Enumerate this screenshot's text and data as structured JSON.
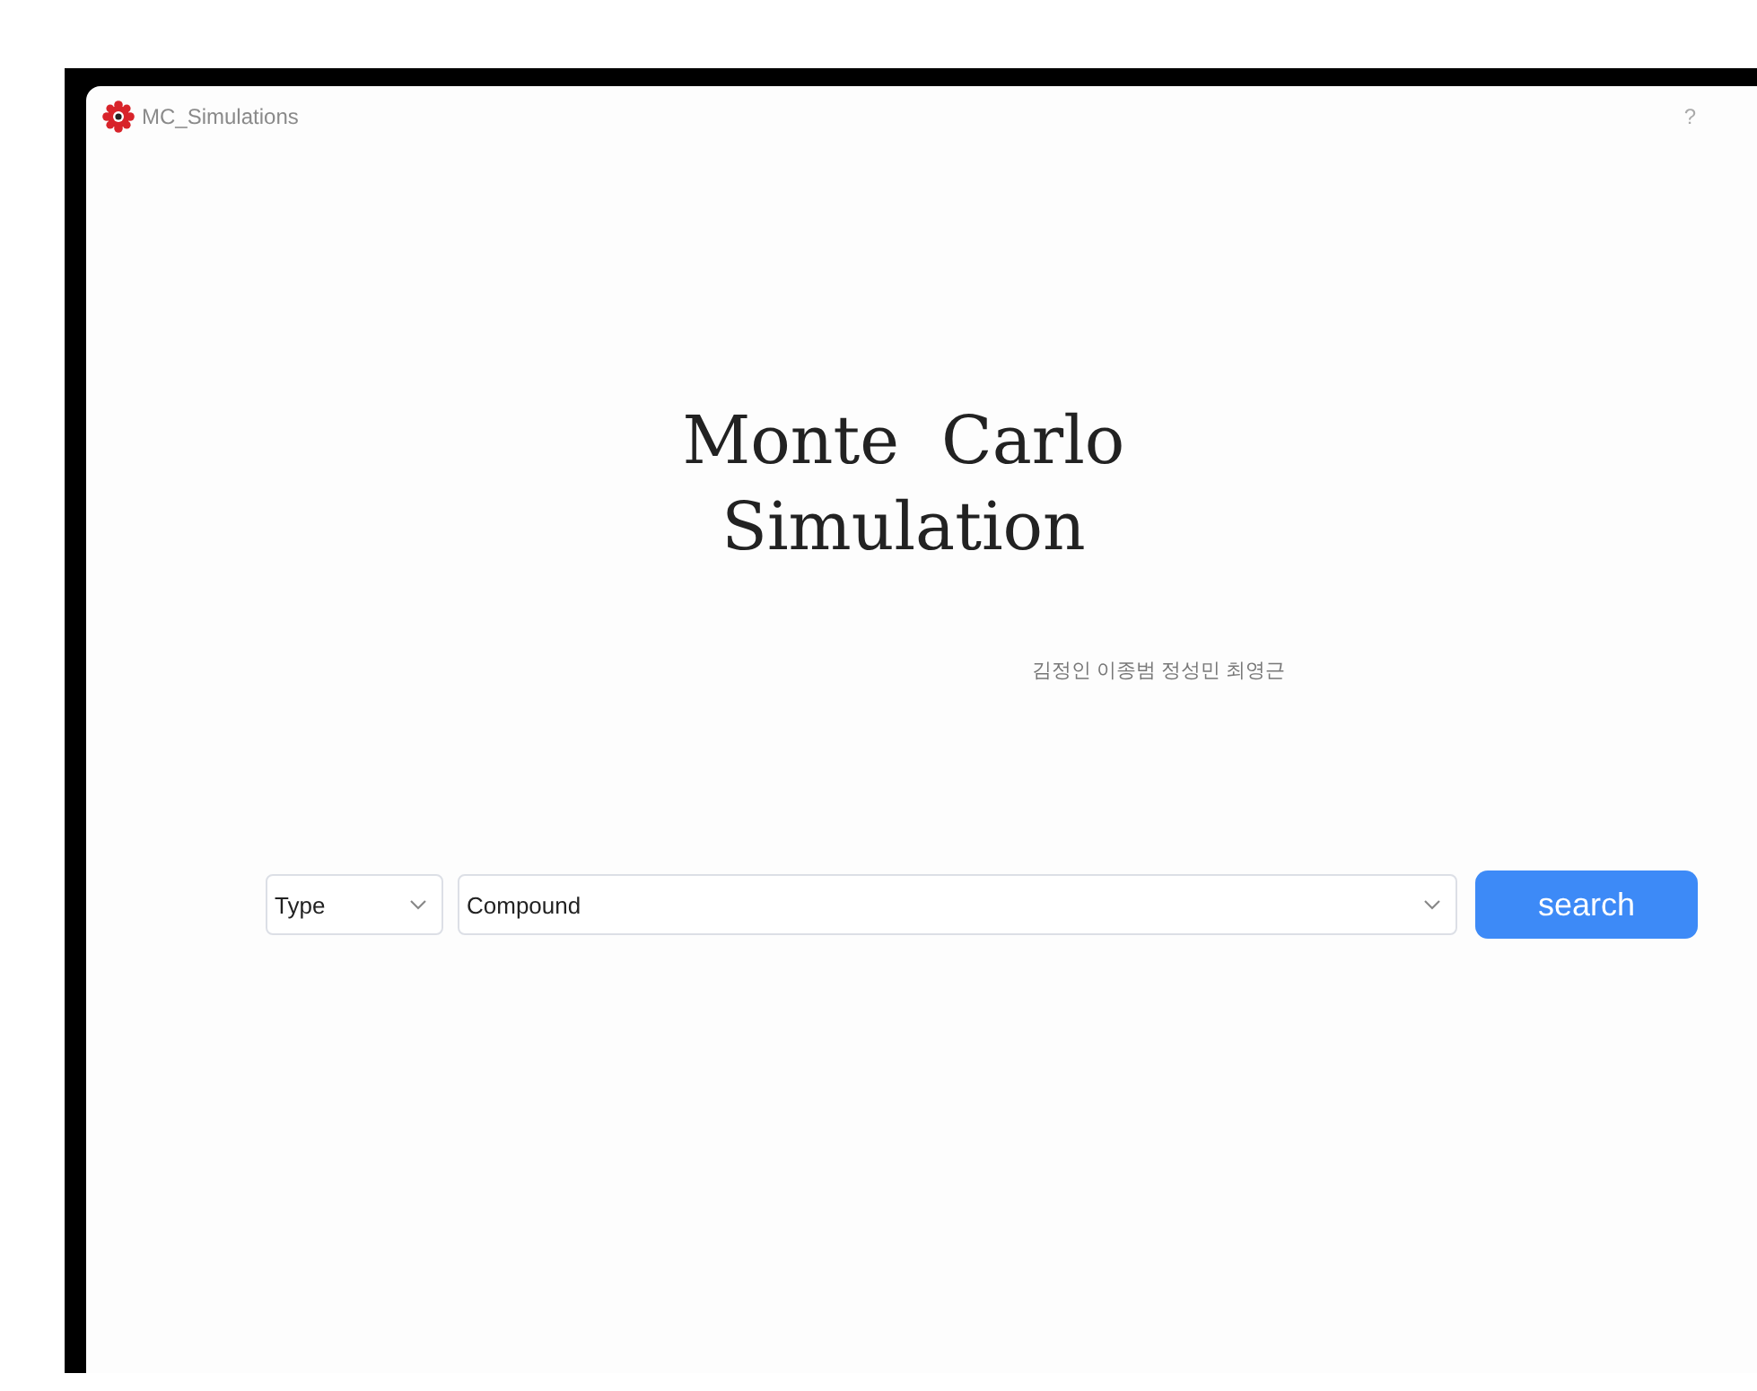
{
  "window": {
    "title": "MC_Simulations",
    "help": "?"
  },
  "heading": {
    "lines": [
      "Monte  Carlo",
      "Simulation"
    ]
  },
  "authors": "김정인 이종범 정성민 최영근",
  "search": {
    "type_select": {
      "value": "Type"
    },
    "compound_select": {
      "value": "Compound"
    },
    "button": "search"
  }
}
